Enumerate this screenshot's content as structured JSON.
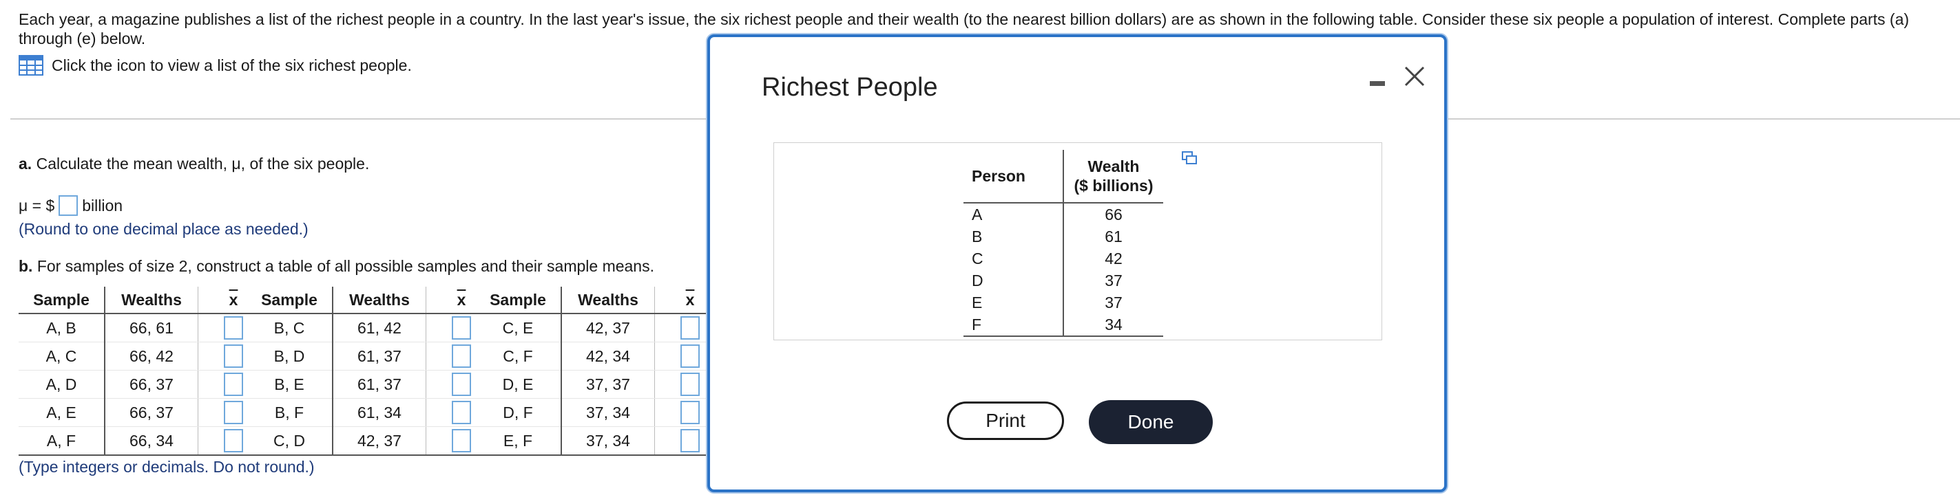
{
  "intro": {
    "text": "Each year, a magazine publishes a list of the richest people in a country. In the last year's issue, the six richest people and their wealth (to the nearest billion dollars) are as shown in the following table. Consider these six people a population of interest. Complete parts (a) through (e) below.",
    "icon_link": "Click the icon to view a list of the six richest people."
  },
  "part_a": {
    "label": "a.",
    "question": "Calculate the mean wealth, μ, of the six people.",
    "prefix": "μ = $",
    "suffix": "billion",
    "hint": "(Round to one decimal place as needed.)"
  },
  "part_b": {
    "label": "b.",
    "question": "For samples of size 2, construct a table of all possible samples and their sample means.",
    "headers": [
      "Sample",
      "Wealths",
      "x"
    ],
    "groups": [
      [
        {
          "sample": "A, B",
          "wealths": "66, 61"
        },
        {
          "sample": "A, C",
          "wealths": "66, 42"
        },
        {
          "sample": "A, D",
          "wealths": "66, 37"
        },
        {
          "sample": "A, E",
          "wealths": "66, 37"
        },
        {
          "sample": "A, F",
          "wealths": "66, 34"
        }
      ],
      [
        {
          "sample": "B, C",
          "wealths": "61, 42"
        },
        {
          "sample": "B, D",
          "wealths": "61, 37"
        },
        {
          "sample": "B, E",
          "wealths": "61, 37"
        },
        {
          "sample": "B, F",
          "wealths": "61, 34"
        },
        {
          "sample": "C, D",
          "wealths": "42, 37"
        }
      ],
      [
        {
          "sample": "C, E",
          "wealths": "42, 37"
        },
        {
          "sample": "C, F",
          "wealths": "42, 34"
        },
        {
          "sample": "D, E",
          "wealths": "37, 37"
        },
        {
          "sample": "D, F",
          "wealths": "37, 34"
        },
        {
          "sample": "E, F",
          "wealths": "37, 34"
        }
      ]
    ],
    "hint": "(Type integers or decimals. Do not round.)"
  },
  "modal": {
    "title": "Richest People",
    "headers": {
      "person": "Person",
      "wealth_line1": "Wealth",
      "wealth_line2": "($ billions)"
    },
    "rows": [
      {
        "person": "A",
        "wealth": "66"
      },
      {
        "person": "B",
        "wealth": "61"
      },
      {
        "person": "C",
        "wealth": "42"
      },
      {
        "person": "D",
        "wealth": "37"
      },
      {
        "person": "E",
        "wealth": "37"
      },
      {
        "person": "F",
        "wealth": "34"
      }
    ],
    "print_label": "Print",
    "done_label": "Done"
  },
  "colors": {
    "accent": "#2b73c7",
    "hint": "#1f3b7a",
    "done_bg": "#1b2232",
    "input_border": "#6fa8dc"
  },
  "icons": [
    "table-icon",
    "minimize-icon",
    "close-icon",
    "copy-icon"
  ]
}
